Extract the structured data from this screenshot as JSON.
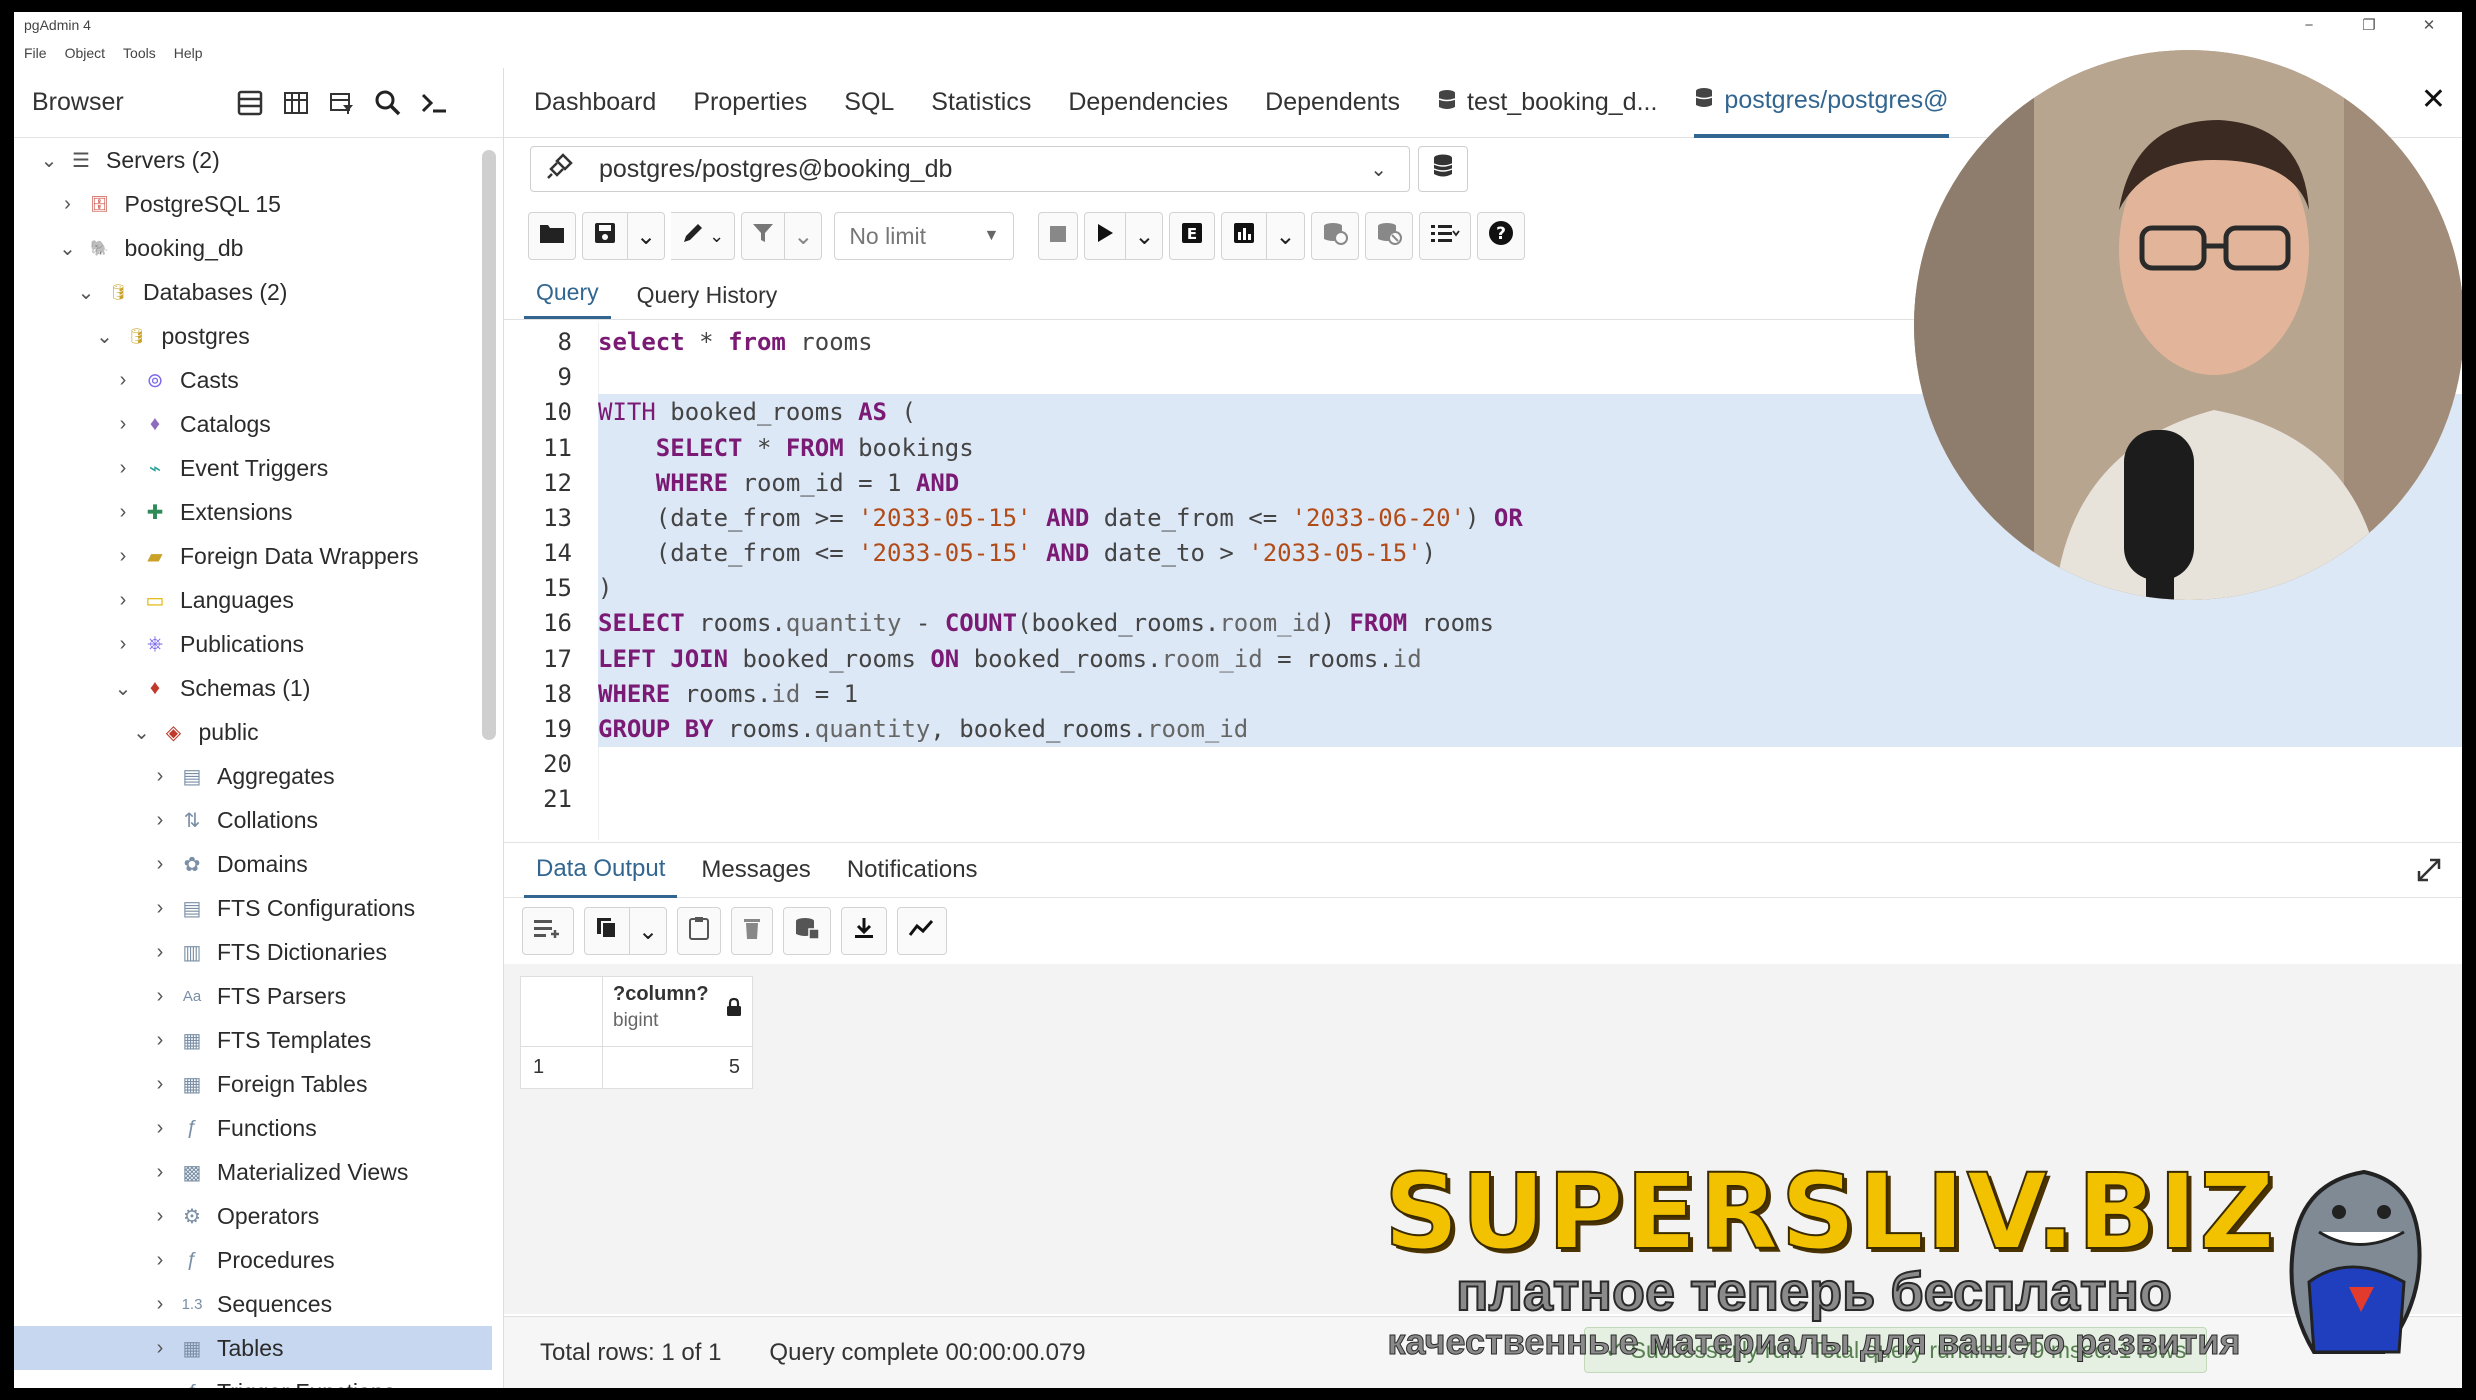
{
  "window": {
    "title": "pgAdmin 4",
    "minimize": "−",
    "maximize": "❐",
    "close": "✕"
  },
  "menu": [
    "File",
    "Object",
    "Tools",
    "Help"
  ],
  "browser": {
    "title": "Browser",
    "tree": [
      {
        "label": "Servers (2)",
        "icon": "servers-icon",
        "glyph": "☰",
        "chev": "⌄",
        "level": 0
      },
      {
        "label": "PostgreSQL 15",
        "icon": "server-off-icon",
        "glyph": "🗄",
        "chev": "›",
        "level": 1
      },
      {
        "label": "booking_db",
        "icon": "elephant-icon",
        "glyph": "🐘",
        "chev": "⌄",
        "level": 1
      },
      {
        "label": "Databases (2)",
        "icon": "databases-icon",
        "glyph": "🛢",
        "chev": "⌄",
        "level": 2
      },
      {
        "label": "postgres",
        "icon": "database-icon",
        "glyph": "🛢",
        "chev": "⌄",
        "level": 3
      },
      {
        "label": "Casts",
        "icon": "casts-icon",
        "glyph": "⊚",
        "chev": "›",
        "level": 4
      },
      {
        "label": "Catalogs",
        "icon": "catalogs-icon",
        "glyph": "♦",
        "chev": "›",
        "level": 4
      },
      {
        "label": "Event Triggers",
        "icon": "event-triggers-icon",
        "glyph": "⌁",
        "chev": "›",
        "level": 4
      },
      {
        "label": "Extensions",
        "icon": "extensions-icon",
        "glyph": "✚",
        "chev": "›",
        "level": 4
      },
      {
        "label": "Foreign Data Wrappers",
        "icon": "fdw-icon",
        "glyph": "▰",
        "chev": "›",
        "level": 4
      },
      {
        "label": "Languages",
        "icon": "languages-icon",
        "glyph": "▭",
        "chev": "›",
        "level": 4
      },
      {
        "label": "Publications",
        "icon": "publications-icon",
        "glyph": "⎈",
        "chev": "›",
        "level": 4
      },
      {
        "label": "Schemas (1)",
        "icon": "schemas-icon",
        "glyph": "♦",
        "chev": "⌄",
        "level": 4
      },
      {
        "label": "public",
        "icon": "schema-icon",
        "glyph": "◈",
        "chev": "⌄",
        "level": 5
      },
      {
        "label": "Aggregates",
        "icon": "aggregates-icon",
        "glyph": "▤",
        "chev": "›",
        "level": 6
      },
      {
        "label": "Collations",
        "icon": "collations-icon",
        "glyph": "⇅",
        "chev": "›",
        "level": 6
      },
      {
        "label": "Domains",
        "icon": "domains-icon",
        "glyph": "✿",
        "chev": "›",
        "level": 6
      },
      {
        "label": "FTS Configurations",
        "icon": "fts-config-icon",
        "glyph": "▤",
        "chev": "›",
        "level": 6
      },
      {
        "label": "FTS Dictionaries",
        "icon": "fts-dict-icon",
        "glyph": "▥",
        "chev": "›",
        "level": 6
      },
      {
        "label": "FTS Parsers",
        "icon": "fts-parsers-icon",
        "glyph": "Aa",
        "chev": "›",
        "level": 6
      },
      {
        "label": "FTS Templates",
        "icon": "fts-templates-icon",
        "glyph": "▦",
        "chev": "›",
        "level": 6
      },
      {
        "label": "Foreign Tables",
        "icon": "foreign-tables-icon",
        "glyph": "▦",
        "chev": "›",
        "level": 6
      },
      {
        "label": "Functions",
        "icon": "functions-icon",
        "glyph": "ƒ",
        "chev": "›",
        "level": 6
      },
      {
        "label": "Materialized Views",
        "icon": "mat-views-icon",
        "glyph": "▩",
        "chev": "›",
        "level": 6
      },
      {
        "label": "Operators",
        "icon": "operators-icon",
        "glyph": "⚙",
        "chev": "›",
        "level": 6
      },
      {
        "label": "Procedures",
        "icon": "procedures-icon",
        "glyph": "ƒ",
        "chev": "›",
        "level": 6
      },
      {
        "label": "Sequences",
        "icon": "sequences-icon",
        "glyph": "1.3",
        "chev": "›",
        "level": 6
      },
      {
        "label": "Tables",
        "icon": "tables-icon",
        "glyph": "▦",
        "chev": "›",
        "level": 6,
        "selected": true
      },
      {
        "label": "Trigger Functions",
        "icon": "trigger-functions-icon",
        "glyph": "ƒ",
        "chev": "›",
        "level": 6
      }
    ]
  },
  "tabs": [
    {
      "label": "Dashboard"
    },
    {
      "label": "Properties"
    },
    {
      "label": "SQL"
    },
    {
      "label": "Statistics"
    },
    {
      "label": "Dependencies"
    },
    {
      "label": "Dependents"
    },
    {
      "label": "test_booking_d...",
      "icon": "query-tool-icon"
    },
    {
      "label": "postgres/postgres@",
      "icon": "query-tool-icon",
      "active": true
    }
  ],
  "connection": {
    "label": "postgres/postgres@booking_db"
  },
  "query_toolbar": {
    "limit": "No limit"
  },
  "query_tabs": [
    "Query",
    "Query History"
  ],
  "editor": {
    "lines": [
      {
        "n": "8",
        "sel": false,
        "html": "<span class=\"kw\">select</span> * <span class=\"kw\">from</span> rooms"
      },
      {
        "n": "9",
        "sel": false,
        "html": ""
      },
      {
        "n": "10",
        "sel": true,
        "html": "<span class=\"kw2\">WITH</span> booked_rooms <span class=\"kw\">AS</span> ("
      },
      {
        "n": "11",
        "sel": true,
        "html": "    <span class=\"kw\">SELECT</span> * <span class=\"kw\">FROM</span> bookings"
      },
      {
        "n": "12",
        "sel": true,
        "html": "    <span class=\"kw\">WHERE</span> room_id = 1 <span class=\"kw\">AND</span>"
      },
      {
        "n": "13",
        "sel": true,
        "html": "    (date_from >= <span class=\"str\">'2033-05-15'</span> <span class=\"kw\">AND</span> date_from <= <span class=\"str\">'2033-06-20'</span>) <span class=\"kw\">OR</span>"
      },
      {
        "n": "14",
        "sel": true,
        "html": "    (date_from <= <span class=\"str\">'2033-05-15'</span> <span class=\"kw\">AND</span> date_to > <span class=\"str\">'2033-05-15'</span>)"
      },
      {
        "n": "15",
        "sel": true,
        "html": ")"
      },
      {
        "n": "16",
        "sel": true,
        "html": "<span class=\"kw\">SELECT</span> rooms.<span class=\"fld\">quantity</span> - <span class=\"kw\">COUNT</span>(booked_rooms.<span class=\"fld\">room_id</span>) <span class=\"kw\">FROM</span> rooms"
      },
      {
        "n": "17",
        "sel": true,
        "html": "<span class=\"kw\">LEFT JOIN</span> booked_rooms <span class=\"kw\">ON</span> booked_rooms.<span class=\"fld\">room_id</span> = rooms.<span class=\"fld\">id</span>"
      },
      {
        "n": "18",
        "sel": true,
        "html": "<span class=\"kw\">WHERE</span> rooms.<span class=\"fld\">id</span> = 1"
      },
      {
        "n": "19",
        "sel": true,
        "html": "<span class=\"kw\">GROUP BY</span> rooms.<span class=\"fld\">quantity</span>, booked_rooms.<span class=\"fld\">room_id</span>"
      },
      {
        "n": "20",
        "sel": false,
        "html": ""
      },
      {
        "n": "21",
        "sel": false,
        "html": ""
      }
    ]
  },
  "result_tabs": [
    "Data Output",
    "Messages",
    "Notifications"
  ],
  "grid": {
    "column": {
      "name": "?column?",
      "type": "bigint"
    },
    "rows": [
      {
        "num": "1",
        "value": "5"
      }
    ]
  },
  "status": {
    "total_rows": "Total rows: 1 of 1",
    "query_complete": "Query complete 00:00:00.079",
    "toast": "✓ Successfully run. Total query runtime: 79 msec. 1 rows"
  },
  "watermark": {
    "title": "SUPERSLIV.BIZ",
    "line1": "платное теперь бесплатно",
    "line2": "качественные материалы для вашего развития"
  }
}
